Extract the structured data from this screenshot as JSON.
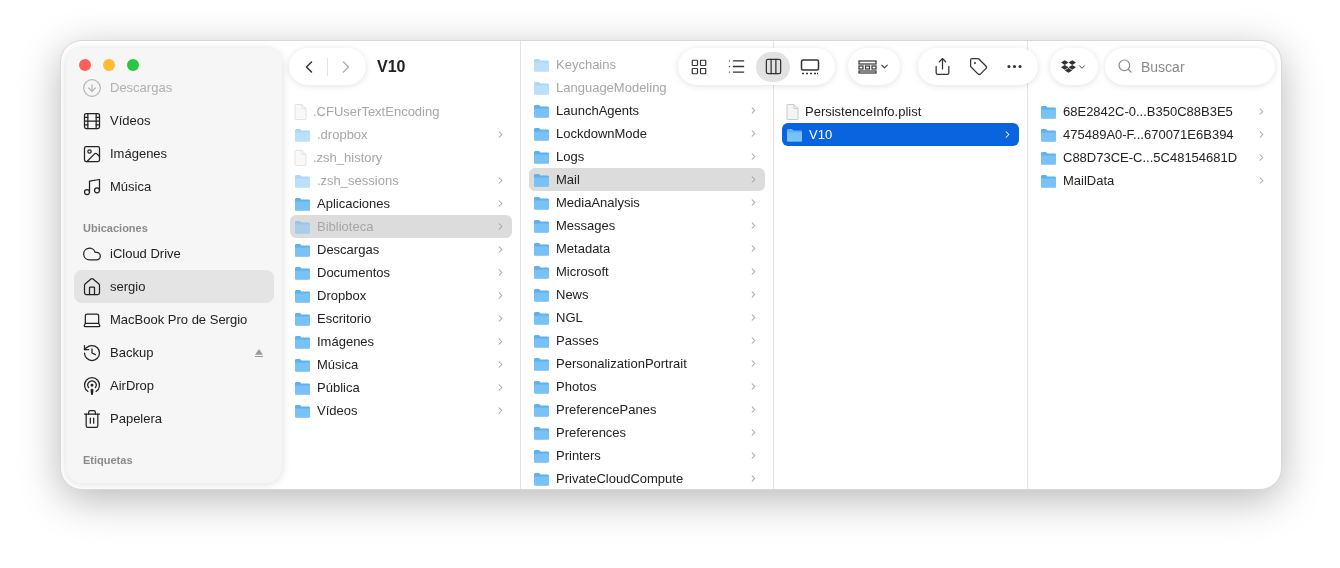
{
  "toolbar": {
    "title": "V10",
    "view_buttons": [
      {
        "kind": "icons",
        "selected": false
      },
      {
        "kind": "list",
        "selected": false
      },
      {
        "kind": "columns",
        "selected": true
      },
      {
        "kind": "gallery",
        "selected": false
      }
    ],
    "search": {
      "placeholder": "Buscar"
    }
  },
  "sidebar": {
    "sections": [
      {
        "items": [
          {
            "label": "Descargas",
            "kind": "downloads",
            "selected": false,
            "dimmed": true,
            "ejectable": false
          },
          {
            "label": "Vídeos",
            "kind": "movies",
            "selected": false,
            "dimmed": false,
            "ejectable": false
          },
          {
            "label": "Imágenes",
            "kind": "pictures",
            "selected": false,
            "dimmed": false,
            "ejectable": false
          },
          {
            "label": "Música",
            "kind": "music",
            "selected": false,
            "dimmed": false,
            "ejectable": false
          }
        ]
      },
      {
        "header": "Ubicaciones",
        "items": [
          {
            "label": "iCloud Drive",
            "kind": "cloud",
            "selected": false,
            "dimmed": false,
            "ejectable": false
          },
          {
            "label": "sergio",
            "kind": "home",
            "selected": true,
            "dimmed": false,
            "ejectable": false
          },
          {
            "label": "MacBook Pro de Sergio",
            "kind": "laptop",
            "selected": false,
            "dimmed": false,
            "ejectable": false
          },
          {
            "label": "Backup",
            "kind": "backup",
            "selected": false,
            "dimmed": false,
            "ejectable": true
          },
          {
            "label": "AirDrop",
            "kind": "airdrop",
            "selected": false,
            "dimmed": false,
            "ejectable": false
          },
          {
            "label": "Papelera",
            "kind": "trash",
            "selected": false,
            "dimmed": false,
            "ejectable": false
          }
        ]
      },
      {
        "header": "Etiquetas"
      }
    ]
  },
  "columns": [
    {
      "items": [
        {
          "name": ".CFUserTextEncoding",
          "kind": "file",
          "dimmed": true,
          "selected": false,
          "focused": false,
          "expandable": false
        },
        {
          "name": ".dropbox",
          "kind": "folder",
          "dimmed": true,
          "selected": false,
          "focused": false,
          "expandable": true
        },
        {
          "name": ".zsh_history",
          "kind": "file",
          "dimmed": true,
          "selected": false,
          "focused": false,
          "expandable": false
        },
        {
          "name": ".zsh_sessions",
          "kind": "folder",
          "dimmed": true,
          "selected": false,
          "focused": false,
          "expandable": true
        },
        {
          "name": "Aplicaciones",
          "kind": "folder",
          "dimmed": false,
          "selected": false,
          "focused": false,
          "expandable": true
        },
        {
          "name": "Biblioteca",
          "kind": "folder",
          "dimmed": true,
          "selected": true,
          "focused": false,
          "expandable": true
        },
        {
          "name": "Descargas",
          "kind": "folder",
          "dimmed": false,
          "selected": false,
          "focused": false,
          "expandable": true
        },
        {
          "name": "Documentos",
          "kind": "folder",
          "dimmed": false,
          "selected": false,
          "focused": false,
          "expandable": true
        },
        {
          "name": "Dropbox",
          "kind": "folder",
          "dimmed": false,
          "selected": false,
          "focused": false,
          "expandable": true
        },
        {
          "name": "Escritorio",
          "kind": "folder",
          "dimmed": false,
          "selected": false,
          "focused": false,
          "expandable": true
        },
        {
          "name": "Imágenes",
          "kind": "folder",
          "dimmed": false,
          "selected": false,
          "focused": false,
          "expandable": true
        },
        {
          "name": "Música",
          "kind": "folder",
          "dimmed": false,
          "selected": false,
          "focused": false,
          "expandable": true
        },
        {
          "name": "Pública",
          "kind": "folder",
          "dimmed": false,
          "selected": false,
          "focused": false,
          "expandable": true
        },
        {
          "name": "Vídeos",
          "kind": "folder",
          "dimmed": false,
          "selected": false,
          "focused": false,
          "expandable": true
        }
      ]
    },
    {
      "items": [
        {
          "name": "Keychains",
          "kind": "folder",
          "dimmed": true,
          "selected": false,
          "focused": false,
          "expandable": false
        },
        {
          "name": "LanguageModeling",
          "kind": "folder",
          "dimmed": true,
          "selected": false,
          "focused": false,
          "expandable": false
        },
        {
          "name": "LaunchAgents",
          "kind": "folder",
          "dimmed": false,
          "selected": false,
          "focused": false,
          "expandable": true
        },
        {
          "name": "LockdownMode",
          "kind": "folder",
          "dimmed": false,
          "selected": false,
          "focused": false,
          "expandable": true
        },
        {
          "name": "Logs",
          "kind": "folder",
          "dimmed": false,
          "selected": false,
          "focused": false,
          "expandable": true
        },
        {
          "name": "Mail",
          "kind": "folder",
          "dimmed": false,
          "selected": true,
          "focused": false,
          "expandable": true
        },
        {
          "name": "MediaAnalysis",
          "kind": "folder",
          "dimmed": false,
          "selected": false,
          "focused": false,
          "expandable": true
        },
        {
          "name": "Messages",
          "kind": "folder",
          "dimmed": false,
          "selected": false,
          "focused": false,
          "expandable": true
        },
        {
          "name": "Metadata",
          "kind": "folder",
          "dimmed": false,
          "selected": false,
          "focused": false,
          "expandable": true
        },
        {
          "name": "Microsoft",
          "kind": "folder",
          "dimmed": false,
          "selected": false,
          "focused": false,
          "expandable": true
        },
        {
          "name": "News",
          "kind": "folder",
          "dimmed": false,
          "selected": false,
          "focused": false,
          "expandable": true
        },
        {
          "name": "NGL",
          "kind": "folder",
          "dimmed": false,
          "selected": false,
          "focused": false,
          "expandable": true
        },
        {
          "name": "Passes",
          "kind": "folder",
          "dimmed": false,
          "selected": false,
          "focused": false,
          "expandable": true
        },
        {
          "name": "PersonalizationPortrait",
          "kind": "folder",
          "dimmed": false,
          "selected": false,
          "focused": false,
          "expandable": true
        },
        {
          "name": "Photos",
          "kind": "folder",
          "dimmed": false,
          "selected": false,
          "focused": false,
          "expandable": true
        },
        {
          "name": "PreferencePanes",
          "kind": "folder",
          "dimmed": false,
          "selected": false,
          "focused": false,
          "expandable": true
        },
        {
          "name": "Preferences",
          "kind": "folder",
          "dimmed": false,
          "selected": false,
          "focused": false,
          "expandable": true
        },
        {
          "name": "Printers",
          "kind": "folder",
          "dimmed": false,
          "selected": false,
          "focused": false,
          "expandable": true
        },
        {
          "name": "PrivateCloudCompute",
          "kind": "folder",
          "dimmed": false,
          "selected": false,
          "focused": false,
          "expandable": true
        }
      ]
    },
    {
      "items": [
        {
          "name": "PersistenceInfo.plist",
          "kind": "file",
          "dimmed": false,
          "selected": false,
          "focused": false,
          "expandable": false
        },
        {
          "name": "V10",
          "kind": "folder",
          "dimmed": false,
          "selected": true,
          "focused": true,
          "expandable": true
        }
      ]
    },
    {
      "items": [
        {
          "name": "68E2842C-0...B350C88B3E5",
          "kind": "folder",
          "dimmed": false,
          "selected": false,
          "focused": false,
          "expandable": true
        },
        {
          "name": "475489A0-F...670071E6B394",
          "kind": "folder",
          "dimmed": false,
          "selected": false,
          "focused": false,
          "expandable": true
        },
        {
          "name": "C88D73CE-C...5C48154681D",
          "kind": "folder",
          "dimmed": false,
          "selected": false,
          "focused": false,
          "expandable": true
        },
        {
          "name": "MailData",
          "kind": "folder",
          "dimmed": false,
          "selected": false,
          "focused": false,
          "expandable": true
        }
      ]
    }
  ]
}
